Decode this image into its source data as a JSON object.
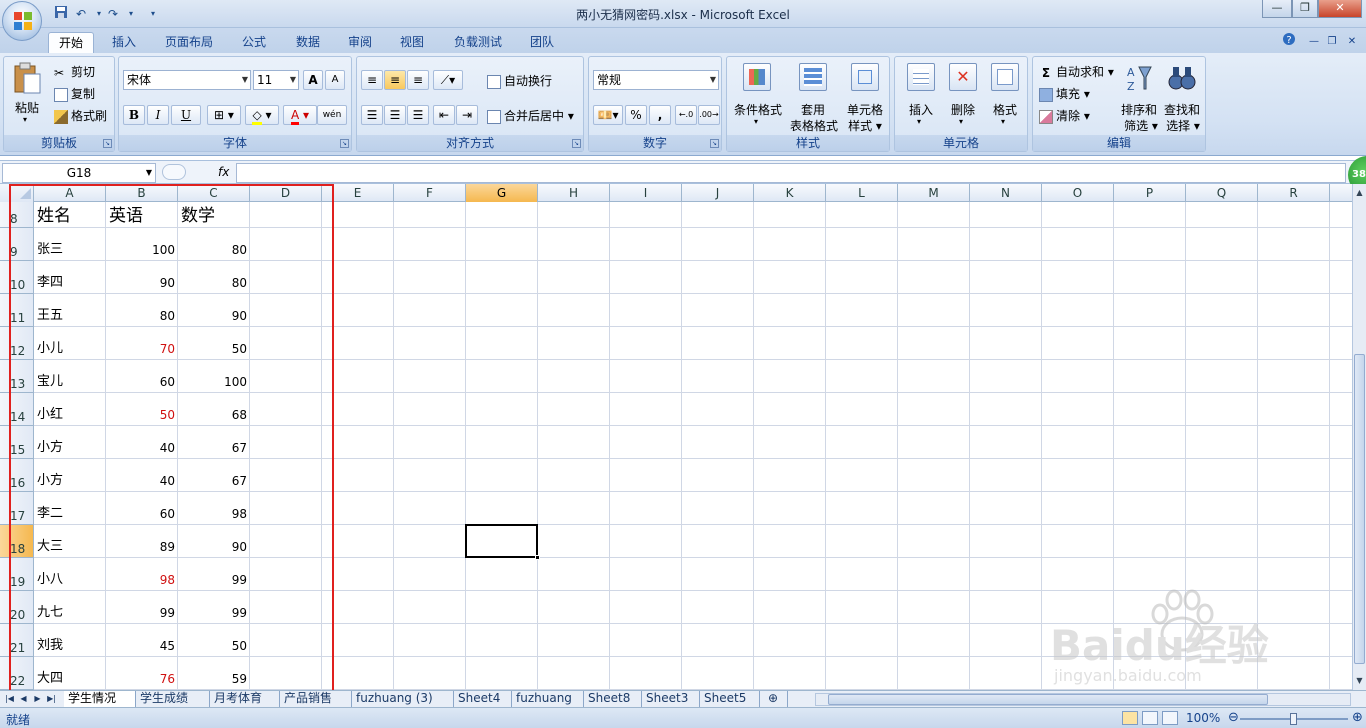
{
  "window": {
    "title": "两小无猜网密码.xlsx - Microsoft Excel"
  },
  "ribbon": {
    "tabs": [
      {
        "label": "开始",
        "active": true
      },
      {
        "label": "插入"
      },
      {
        "label": "页面布局"
      },
      {
        "label": "公式"
      },
      {
        "label": "数据"
      },
      {
        "label": "审阅"
      },
      {
        "label": "视图"
      },
      {
        "label": "负载测试"
      },
      {
        "label": "团队"
      }
    ],
    "clipboard": {
      "group": "剪贴板",
      "paste": "粘贴",
      "cut": "剪切",
      "copy": "复制",
      "format_painter": "格式刷"
    },
    "font": {
      "group": "字体",
      "name": "宋体",
      "size": "11",
      "bold": "B",
      "italic": "I",
      "underline": "U",
      "grow": "A",
      "shrink": "A",
      "phonetic": "wén"
    },
    "alignment": {
      "group": "对齐方式",
      "wrap": "自动换行",
      "merge": "合并后居中"
    },
    "number": {
      "group": "数字",
      "format": "常规",
      "percent": "%",
      "comma": ","
    },
    "styles": {
      "group": "样式",
      "conditional": "条件格式",
      "table_1": "套用",
      "table_2": "表格格式",
      "cell_1": "单元格",
      "cell_2": "样式"
    },
    "cells": {
      "group": "单元格",
      "insert": "插入",
      "delete": "删除",
      "format": "格式"
    },
    "editing": {
      "group": "编辑",
      "autosum": "自动求和",
      "fill": "填充",
      "clear": "清除",
      "sort_1": "排序和",
      "sort_2": "筛选",
      "find_1": "查找和",
      "find_2": "选择"
    }
  },
  "formula_bar": {
    "name_box": "G18",
    "fx": "fx",
    "value": ""
  },
  "columns": [
    "A",
    "B",
    "C",
    "D",
    "E",
    "F",
    "G",
    "H",
    "I",
    "J",
    "K",
    "L",
    "M",
    "N",
    "O",
    "P",
    "Q",
    "R"
  ],
  "selected_column": "G",
  "rows": [
    "8",
    "9",
    "10",
    "11",
    "12",
    "13",
    "14",
    "15",
    "16",
    "17",
    "18",
    "19",
    "20",
    "21",
    "22"
  ],
  "selected_row": "18",
  "table": {
    "headers": [
      "姓名",
      "英语",
      "数学"
    ],
    "records": [
      {
        "name": "张三",
        "english": "100",
        "math": "80",
        "english_red": false
      },
      {
        "name": "李四",
        "english": "90",
        "math": "80",
        "english_red": false
      },
      {
        "name": "王五",
        "english": "80",
        "math": "90",
        "english_red": false
      },
      {
        "name": "小儿",
        "english": "70",
        "math": "50",
        "english_red": true
      },
      {
        "name": "宝儿",
        "english": "60",
        "math": "100",
        "english_red": false
      },
      {
        "name": "小红",
        "english": "50",
        "math": "68",
        "english_red": true
      },
      {
        "name": "小方",
        "english": "40",
        "math": "67",
        "english_red": false
      },
      {
        "name": "小方",
        "english": "40",
        "math": "67",
        "english_red": false
      },
      {
        "name": "李二",
        "english": "60",
        "math": "98",
        "english_red": false
      },
      {
        "name": "大三",
        "english": "89",
        "math": "90",
        "english_red": false
      },
      {
        "name": "小八",
        "english": "98",
        "math": "99",
        "english_red": true
      },
      {
        "name": "九七",
        "english": "99",
        "math": "99",
        "english_red": false
      },
      {
        "name": "刘我",
        "english": "45",
        "math": "50",
        "english_red": false
      },
      {
        "name": "大四",
        "english": "76",
        "math": "59",
        "english_red": true
      }
    ]
  },
  "sheets": [
    "学生情况",
    "学生成绩",
    "月考体育",
    "产品销售",
    "fuzhuang (3)",
    "Sheet4",
    "fuzhuang",
    "Sheet8",
    "Sheet3",
    "Sheet5"
  ],
  "active_sheet": "学生情况",
  "status": {
    "ready": "就绪",
    "zoom": "100%"
  },
  "badge": {
    "value": "38"
  },
  "watermark": {
    "brand": "Baidu经验",
    "url": "jingyan.baidu.com"
  },
  "colors": {
    "accent_red": "#e0201e",
    "value_red": "#d01010",
    "selected_header": "#f5b84f"
  }
}
